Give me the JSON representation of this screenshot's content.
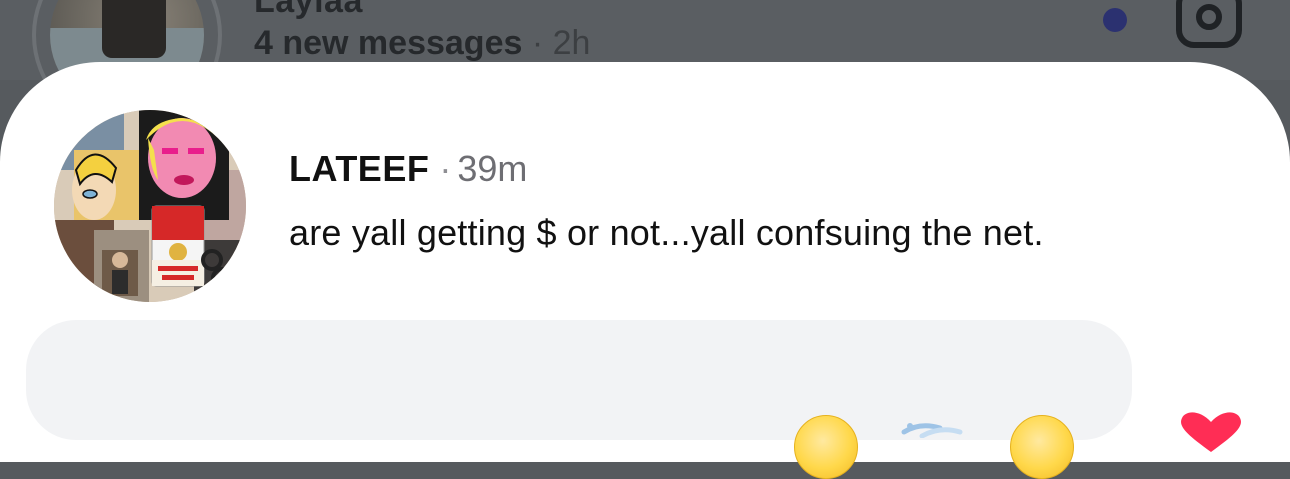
{
  "background_conversation": {
    "name": "Laylaa",
    "preview": "4 new messages",
    "separator": "·",
    "time": "2h"
  },
  "notification": {
    "sender": "LATEEF",
    "separator": "·",
    "time": "39m",
    "message": "are yall getting $ or not...yall confsuing the net."
  },
  "icons": {
    "camera": "camera-icon",
    "unread": "unread-dot",
    "heart": "heart-icon",
    "emoji_1": "emoji-face-icon",
    "emoji_2": "emoji-wind-icon",
    "emoji_3": "emoji-face-icon"
  },
  "colors": {
    "unread_dot": "#2b3170",
    "heart": "#ff2d55",
    "reply_bar": "#f2f3f5"
  }
}
